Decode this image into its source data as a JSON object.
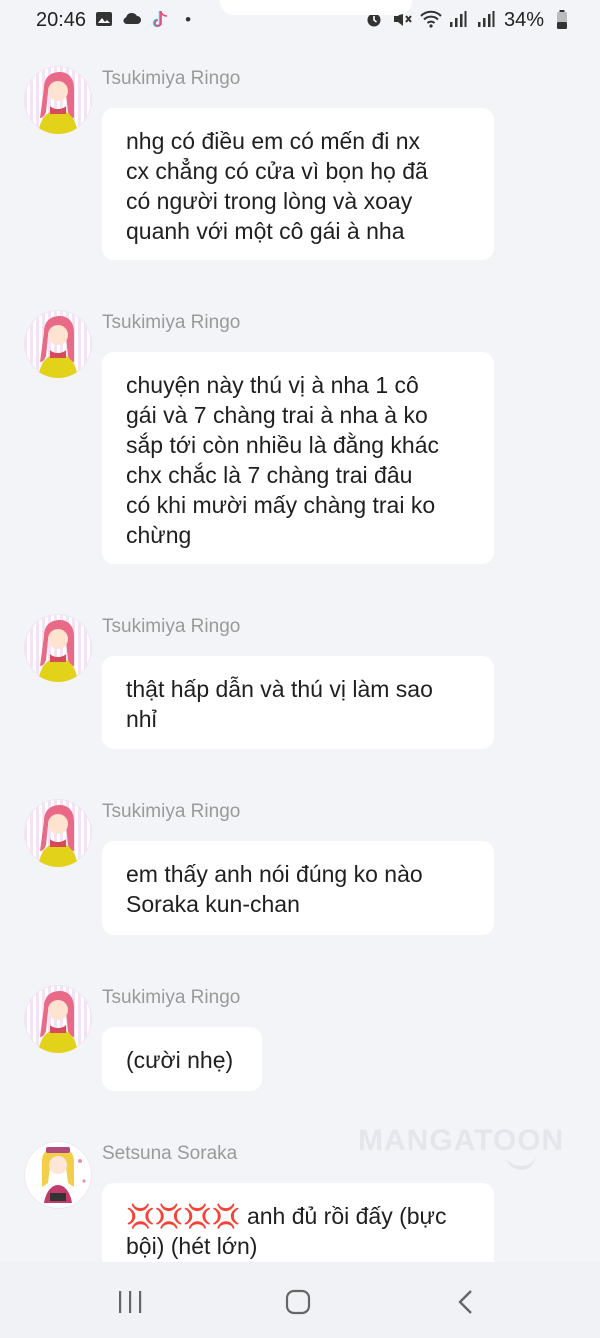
{
  "status_bar": {
    "time": "20:46",
    "battery": "34%",
    "left_icons": [
      "image-icon",
      "cloud-icon",
      "tiktok-icon",
      "dot-icon"
    ],
    "right_icons": [
      "alarm-icon",
      "mute-icon",
      "wifi-icon",
      "signal-icon",
      "signal-icon",
      "battery-icon"
    ]
  },
  "messages": [
    {
      "sender": "Tsukimiya Ringo",
      "avatar": "ringo-avatar",
      "lines": [
        "nhg có điều em có mến đi nx",
        "cx chẳng có cửa vì bọn họ đã",
        "có người trong lòng và xoay",
        "quanh với một cô gái à nha"
      ]
    },
    {
      "sender": "Tsukimiya Ringo",
      "avatar": "ringo-avatar",
      "lines": [
        "chuyện này thú vị à nha 1 cô",
        "gái và 7 chàng trai à nha à ko",
        "sắp tới còn nhiều là đằng khác",
        "chx chắc là 7 chàng trai đâu",
        "có khi mười mấy chàng trai ko",
        "chừng"
      ]
    },
    {
      "sender": "Tsukimiya Ringo",
      "avatar": "ringo-avatar",
      "lines": [
        "thật hấp dẫn và thú vị làm sao",
        "nhỉ"
      ]
    },
    {
      "sender": "Tsukimiya Ringo",
      "avatar": "ringo-avatar",
      "lines": [
        "em thấy anh nói đúng ko nào",
        "Soraka kun-chan"
      ]
    },
    {
      "sender": "Tsukimiya Ringo",
      "avatar": "ringo-avatar",
      "lines": [
        "(cười nhẹ)"
      ]
    },
    {
      "sender": "Setsuna Soraka",
      "avatar": "soraka-avatar",
      "lines": [
        "💢💢💢💢 anh đủ rồi đấy (bực",
        "bội) (hét lớn)"
      ]
    }
  ],
  "watermark": "MANGATOON",
  "nav": {
    "recent_icon": "recent-apps-icon",
    "home_icon": "home-icon",
    "back_icon": "back-icon"
  }
}
